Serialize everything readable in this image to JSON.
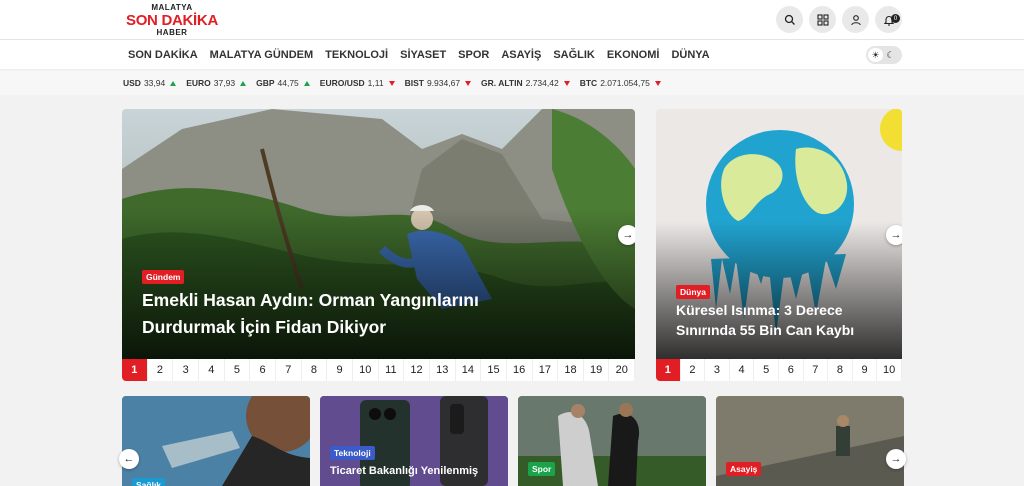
{
  "logo": {
    "line1": "MALATYA",
    "line2": "SON DAKİKA",
    "line3": "HABER"
  },
  "header_icons": [
    "search-icon",
    "grid-icon",
    "user-icon",
    "bell-icon"
  ],
  "notification_count": "0",
  "nav": {
    "items": [
      "SON DAKİKA",
      "MALATYA GÜNDEM",
      "TEKNOLOJİ",
      "SİYASET",
      "SPOR",
      "ASAYİŞ",
      "SAĞLIK",
      "EKONOMİ",
      "DÜNYA"
    ]
  },
  "ticker": [
    {
      "label": "USD",
      "value": "33,94",
      "trend": "up"
    },
    {
      "label": "EURO",
      "value": "37,93",
      "trend": "up"
    },
    {
      "label": "GBP",
      "value": "44,75",
      "trend": "up"
    },
    {
      "label": "EURO/USD",
      "value": "1,11",
      "trend": "down"
    },
    {
      "label": "BIST",
      "value": "9.934,67",
      "trend": "down"
    },
    {
      "label": "GR. ALTIN",
      "value": "2.734,42",
      "trend": "down"
    },
    {
      "label": "BTC",
      "value": "2.071.054,75",
      "trend": "down"
    }
  ],
  "main_slider": {
    "category": "Gündem",
    "category_color": "#e21e25",
    "headline": "Emekli Hasan Aydın: Orman Yangınlarını Durdurmak İçin Fidan Dikiyor",
    "pages": [
      "1",
      "2",
      "3",
      "4",
      "5",
      "6",
      "7",
      "8",
      "9",
      "10",
      "11",
      "12",
      "13",
      "14",
      "15",
      "16",
      "17",
      "18",
      "19",
      "20"
    ]
  },
  "side_slider": {
    "category": "Dünya",
    "category_color": "#e21e25",
    "headline": "Küresel Isınma: 3 Derece Sınırında 55 Bin Can Kaybı",
    "pages": [
      "1",
      "2",
      "3",
      "4",
      "5",
      "6",
      "7",
      "8",
      "9",
      "10"
    ]
  },
  "cards": [
    {
      "category": "Sağlık",
      "category_color": "#1b9ad1",
      "headline": ""
    },
    {
      "category": "Teknoloji",
      "category_color": "#3b5bc9",
      "headline": "Ticaret Bakanlığı Yenilenmiş"
    },
    {
      "category": "Spor",
      "category_color": "#1aa34a",
      "headline": ""
    },
    {
      "category": "Asayiş",
      "category_color": "#e21e25",
      "headline": ""
    }
  ],
  "colors": {
    "brand": "#e21e25",
    "up": "#1aa34a",
    "down": "#e21e25"
  }
}
